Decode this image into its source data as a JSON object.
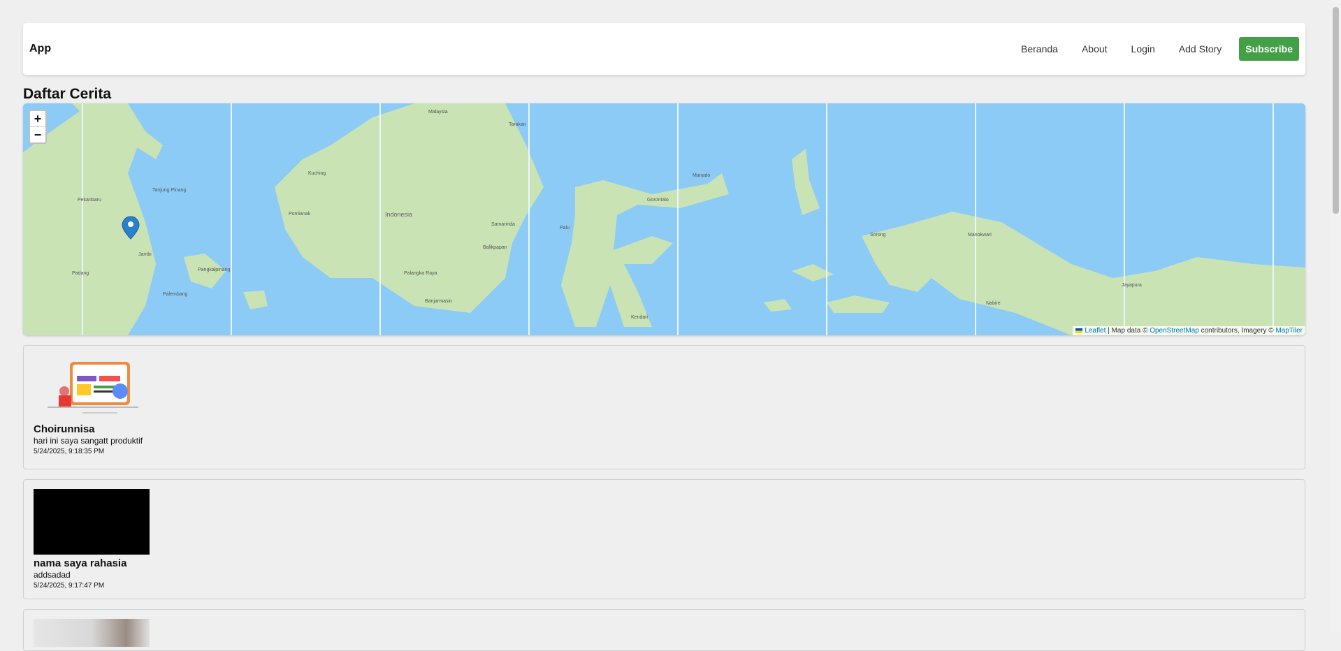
{
  "navbar": {
    "brand": "App",
    "links": [
      "Beranda",
      "About",
      "Login",
      "Add Story"
    ],
    "subscribe_label": "Subscribe"
  },
  "page_title": "Daftar Cerita",
  "map": {
    "zoom_in": "+",
    "zoom_out": "−",
    "attribution": {
      "leaflet": "Leaflet",
      "sep1": " | Map data © ",
      "osm": "OpenStreetMap",
      "sep2": " contributors, Imagery © ",
      "maptiler": "MapTiler"
    },
    "labels": {
      "indonesia": "Indonesia",
      "jambi": "Jambi",
      "palembang": "Palembang",
      "pangkalpinang": "Pangkalpinang",
      "pontianak": "Pontianak",
      "palangka_raya": "Palangka Raya",
      "banjarmasin": "Banjarmasin",
      "samarinda": "Samarinda",
      "balikpapan": "Balikpapan",
      "gorontalo": "Gorontalo",
      "manado": "Manado",
      "palu": "Palu",
      "kendari": "Kendari",
      "sorong": "Sorong",
      "manokwari": "Manokwari",
      "malaysia": "Malaysia",
      "kuching": "Kuching",
      "pekanbaru": "Pekanbaru",
      "padang": "Padang",
      "jayapura": "Jayapura",
      "nabire": "Nabire",
      "tarakan": "Tarakan",
      "tanjung_pinang": "Tanjung Pinang"
    }
  },
  "stories": [
    {
      "name": "Choirunnisa",
      "description": "hari ini saya sangatt produktif",
      "date": "5/24/2025, 9:18:35 PM"
    },
    {
      "name": "nama saya rahasia",
      "description": "addsadad",
      "date": "5/24/2025, 9:17:47 PM"
    }
  ],
  "colors": {
    "accent": "#43a047",
    "sea": "#8ccbf6",
    "land": "#c9e3b5",
    "marker": "#2a81cb"
  }
}
